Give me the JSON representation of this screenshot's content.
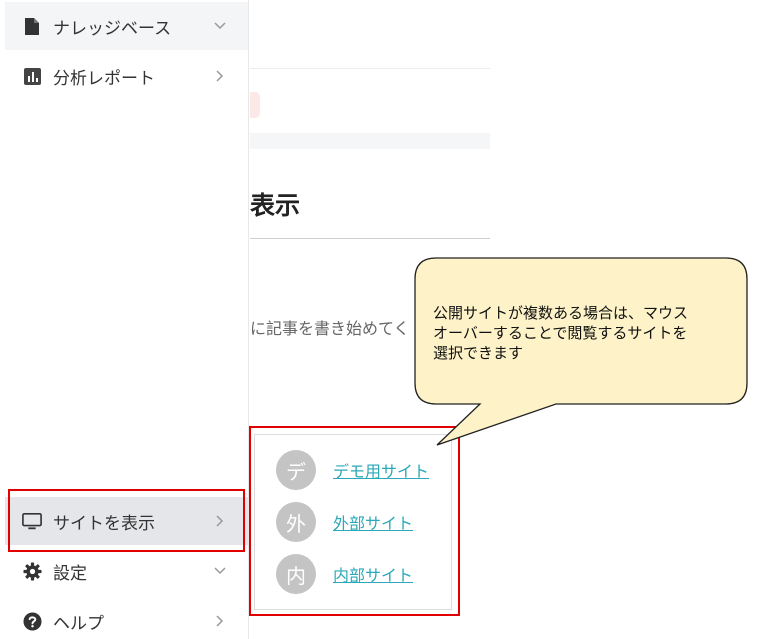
{
  "sidebar": {
    "items": [
      {
        "label": "ナレッジベース",
        "icon": "document-icon",
        "chevron": "chevron-down-icon"
      },
      {
        "label": "分析レポート",
        "icon": "bar-chart-icon",
        "chevron": "chevron-right-icon"
      },
      {
        "label": "サイトを表示",
        "icon": "monitor-icon",
        "chevron": "chevron-right-icon"
      },
      {
        "label": "設定",
        "icon": "gear-icon",
        "chevron": "chevron-down-icon"
      },
      {
        "label": "ヘルプ",
        "icon": "help-icon",
        "chevron": "chevron-right-icon"
      }
    ]
  },
  "main": {
    "title_fragment": "表示",
    "body_fragment": "に記事を書き始めてく"
  },
  "site_menu": {
    "sites": [
      {
        "avatar": "デ",
        "label": "デモ用サイト"
      },
      {
        "avatar": "外",
        "label": "外部サイト"
      },
      {
        "avatar": "内",
        "label": "内部サイト"
      }
    ]
  },
  "callout": {
    "lines": [
      "公開サイトが複数ある場合は、マウス",
      "オーバーすることで閲覧するサイトを",
      "選択できます"
    ]
  },
  "colors": {
    "annotation_red": "#e00000",
    "link": "#2ba9b8",
    "callout_fill": "#fdf2c8",
    "avatar": "#c4c4c4"
  }
}
